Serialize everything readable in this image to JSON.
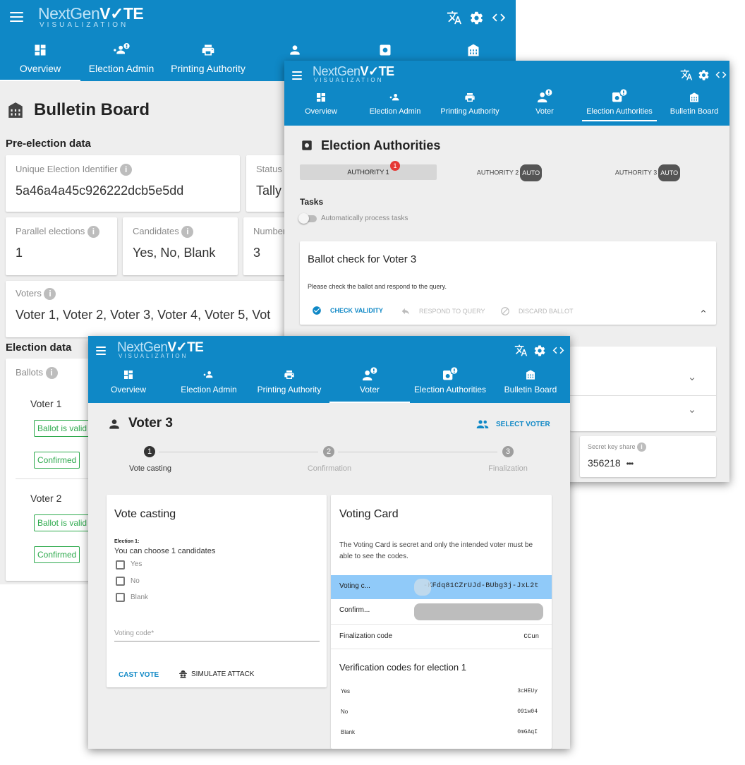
{
  "brand": {
    "ng": "NextGen",
    "vote": "V✓TE",
    "sub": "VISUALIZATION"
  },
  "tabs": {
    "overview": "Overview",
    "election_admin": "Election Admin",
    "printing_authority": "Printing Authority",
    "voter": "Voter",
    "election_authorities": "Election Authorities",
    "bulletin_board": "Bulletin Board"
  },
  "bulletin": {
    "title": "Bulletin Board",
    "pre_election_heading": "Pre-election data",
    "uid_label": "Unique Election Identifier",
    "uid_value": "5a46a4a45c926222dcb5e5dd",
    "status_label": "Status",
    "status_value": "Tally",
    "parallel_label": "Parallel elections",
    "parallel_value": "1",
    "candidates_label": "Candidates",
    "candidates_value": "Yes, No, Blank",
    "number_label": "Number",
    "number_value": "3",
    "voters_label": "Voters",
    "voters_value": "Voter 1, Voter 2, Voter 3, Voter 4, Voter 5, Vot",
    "election_data_heading": "Election data",
    "ballots_label": "Ballots",
    "ballots": [
      {
        "voter": "Voter 1",
        "valid": "Ballot is valid",
        "confirmed": "Confirmed"
      },
      {
        "voter": "Voter 2",
        "valid": "Ballot is valid",
        "confirmed": "Confirmed"
      }
    ]
  },
  "authorities": {
    "title": "Election Authorities",
    "auth_tabs": [
      {
        "label": "AUTHORITY 1",
        "badge": "1"
      },
      {
        "label": "AUTHORITY 2",
        "badge": "AUTO"
      },
      {
        "label": "AUTHORITY 3",
        "badge": "AUTO"
      }
    ],
    "tasks_label": "Tasks",
    "toggle_label": "Automatically process tasks",
    "task_title": "Ballot check for Voter 3",
    "task_desc": "Please check the ballot and respond to the query.",
    "check_validity": "CHECK VALIDITY",
    "respond_query": "RESPOND TO QUERY",
    "discard_ballot": "DISCARD BALLOT",
    "secret_key_label": "Secret key share",
    "secret_key_value": "356218",
    "more": "•••"
  },
  "voter": {
    "title": "Voter 3",
    "select_voter": "SELECT VOTER",
    "steps": [
      {
        "num": "1",
        "label": "Vote casting"
      },
      {
        "num": "2",
        "label": "Confirmation"
      },
      {
        "num": "3",
        "label": "Finalization"
      }
    ],
    "vote_card": {
      "title": "Vote casting",
      "election_label": "Election 1:",
      "choose_text": "You can choose 1 candidates",
      "options": [
        "Yes",
        "No",
        "Blank"
      ],
      "code_placeholder": "Voting code*",
      "cast_vote": "CAST VOTE",
      "simulate_attack": "SIMULATE ATTACK"
    },
    "voting_card": {
      "title": "Voting Card",
      "desc": "The Voting Card is secret and only the intended voter must be able to see the codes.",
      "voting_code_label": "Voting c...",
      "voting_code_value": "-KFdq81CZrUJd-BUbg3j-JxL2t",
      "confirm_label": "Confirm...",
      "finalization_label": "Finalization code",
      "finalization_value": "CCun",
      "verification_title": "Verification codes for election 1",
      "codes": [
        {
          "option": "Yes",
          "code": "3cHEUy"
        },
        {
          "option": "No",
          "code": "091w04"
        },
        {
          "option": "Blank",
          "code": "0mGAqI"
        }
      ]
    }
  },
  "colors": {
    "primary": "#0f88c6",
    "valid": "#2eaa4d",
    "badge": "#e53935",
    "highlight": "#90caf9"
  }
}
